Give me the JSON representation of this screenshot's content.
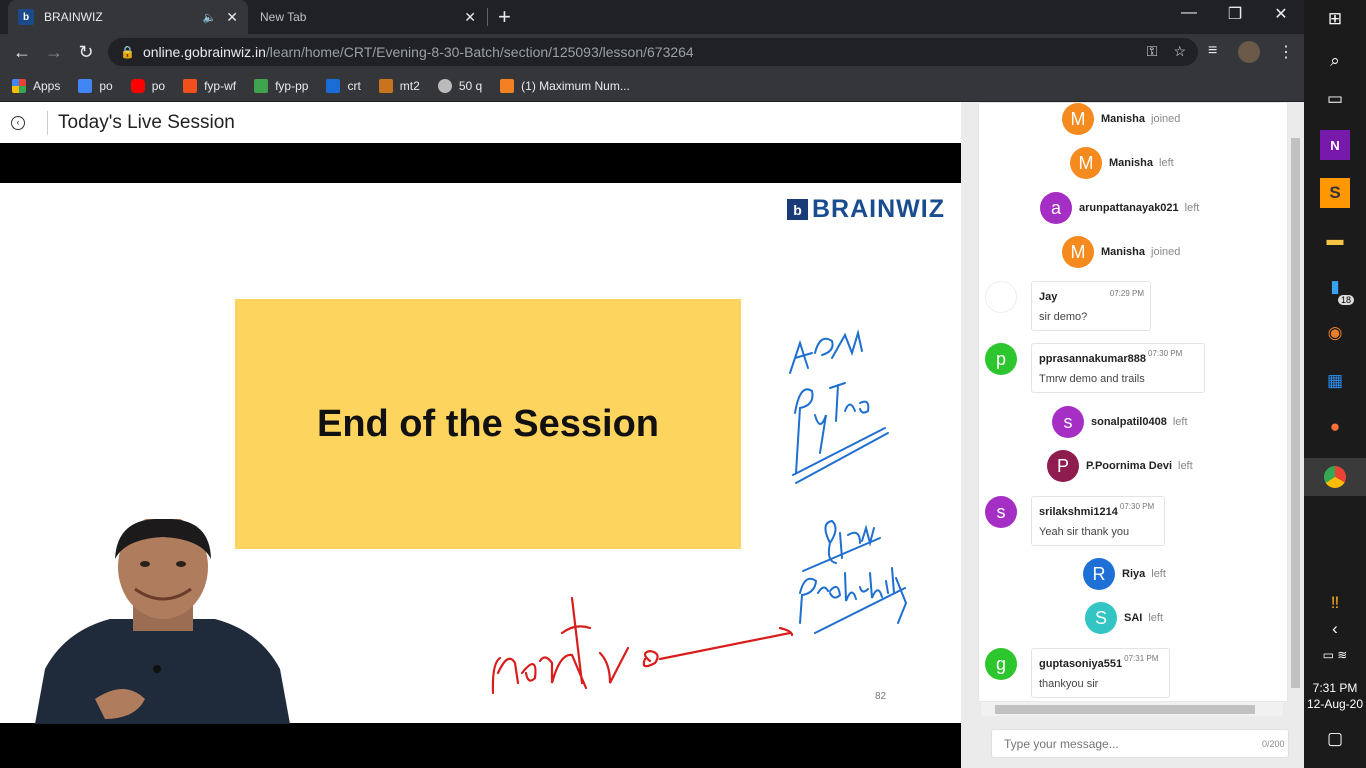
{
  "tabs": [
    {
      "title": "BRAINWIZ",
      "active": true
    },
    {
      "title": "New Tab",
      "active": false
    }
  ],
  "address": {
    "host": "online.gobrainwiz.in",
    "path": "/learn/home/CRT/Evening-8-30-Batch/section/125093/lesson/673264"
  },
  "bookmarks": [
    {
      "label": "Apps",
      "color": "#4a90d9"
    },
    {
      "label": "po",
      "color": "#4285f4"
    },
    {
      "label": "po",
      "color": "#ff0000"
    },
    {
      "label": "fyp-wf",
      "color": "#f24e1e"
    },
    {
      "label": "fyp-pp",
      "color": "#3fa34d"
    },
    {
      "label": "crt",
      "color": "#1a6dd6"
    },
    {
      "label": "mt2",
      "color": "#c8741c"
    },
    {
      "label": "50 q",
      "color": "#bbbbbb"
    },
    {
      "label": "(1) Maximum Num...",
      "color": "#f48024"
    }
  ],
  "session": {
    "title": "Today's Live Session"
  },
  "slide": {
    "logo_mark": "b",
    "logo": "BRAINWIZ",
    "heading": "End of the Session",
    "page_number": "82"
  },
  "chat": {
    "events": [
      {
        "name": "Manisha",
        "action": "joined",
        "initial": "M",
        "color": "#f58a1f"
      },
      {
        "name": "Manisha",
        "action": "left",
        "initial": "M",
        "color": "#f58a1f"
      },
      {
        "name": "arunpattanayak021",
        "action": "left",
        "initial": "a",
        "color": "#a52ec4"
      },
      {
        "name": "Manisha",
        "action": "joined",
        "initial": "M",
        "color": "#f58a1f"
      },
      {
        "name": "sonalpatil0408",
        "action": "left",
        "initial": "s",
        "color": "#a52ec4"
      },
      {
        "name": "P.Poornima Devi",
        "action": "left",
        "initial": "P",
        "color": "#8e1c4e"
      },
      {
        "name": "Riya",
        "action": "left",
        "initial": "R",
        "color": "#1e6fd6"
      },
      {
        "name": "SAI",
        "action": "left",
        "initial": "S",
        "color": "#33c4c4"
      }
    ],
    "messages": [
      {
        "name": "Jay",
        "time": "07:29 PM",
        "text": "sir demo?",
        "initial": "",
        "color": "#ffffff"
      },
      {
        "name": "pprasannakumar888",
        "time": "07:30 PM",
        "text": "Tmrw demo and trails",
        "initial": "p",
        "color": "#2ec62e"
      },
      {
        "name": "srilakshmi1214",
        "time": "07:30 PM",
        "text": "Yeah sir thank you",
        "initial": "s",
        "color": "#a52ec4"
      },
      {
        "name": "guptasoniya551",
        "time": "07:31 PM",
        "text": "thankyou sir",
        "initial": "g",
        "color": "#2ec62e"
      }
    ],
    "input_placeholder": "Type your message...",
    "char_count": "0/200"
  },
  "taskbar": {
    "time": "7:31 PM",
    "date": "12-Aug-20",
    "badge": "18"
  }
}
